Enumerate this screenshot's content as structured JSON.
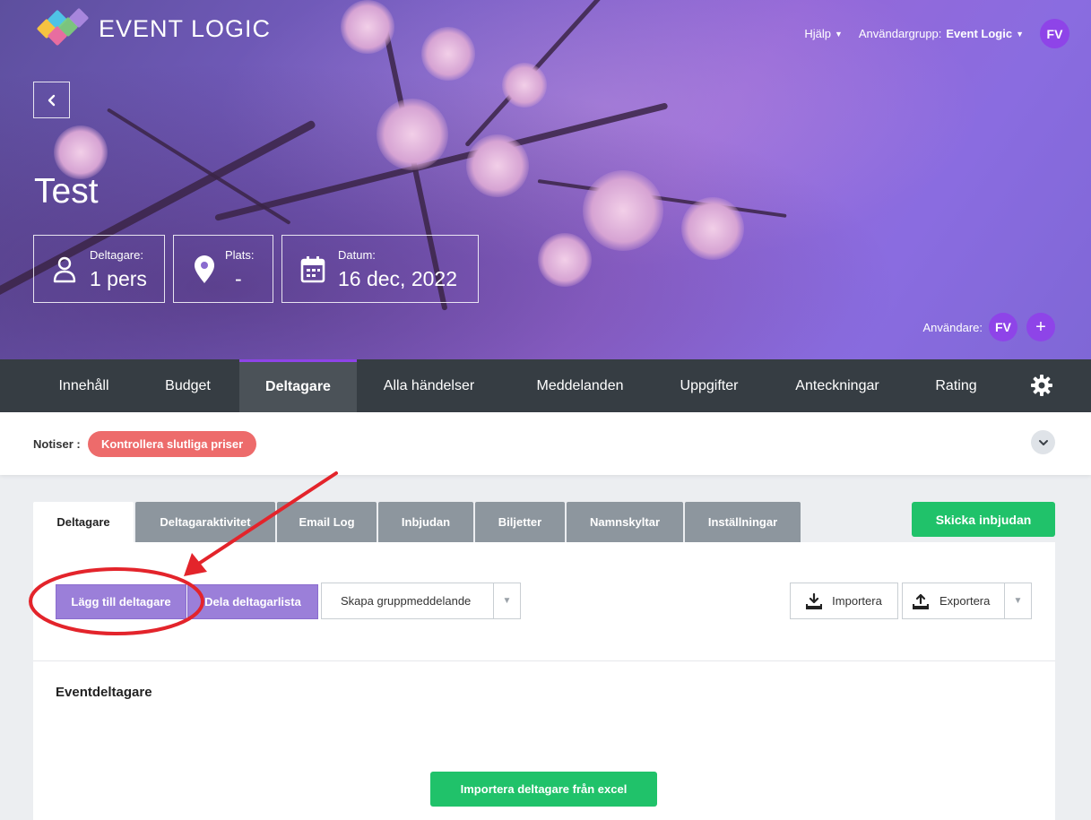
{
  "header": {
    "app_name": "EVENT LOGIC",
    "help_label": "Hjälp",
    "user_group_label": "Användargrupp:",
    "user_group_value": "Event Logic",
    "avatar_initials": "FV"
  },
  "event": {
    "title": "Test",
    "stats": [
      {
        "label": "Deltagare:",
        "value": "1 pers",
        "icon": "person-icon"
      },
      {
        "label": "Plats:",
        "value": "-",
        "icon": "location-pin-icon"
      },
      {
        "label": "Datum:",
        "value": "16 dec, 2022",
        "icon": "calendar-icon"
      }
    ],
    "users_label": "Användare:",
    "users_avatar": "FV",
    "add_user_symbol": "+"
  },
  "main_tabs": [
    {
      "label": "Innehåll"
    },
    {
      "label": "Budget"
    },
    {
      "label": "Deltagare",
      "active": true
    },
    {
      "label": "Alla händelser"
    },
    {
      "label": "Meddelanden"
    },
    {
      "label": "Uppgifter"
    },
    {
      "label": "Anteckningar"
    },
    {
      "label": "Rating"
    }
  ],
  "notices": {
    "label": "Notiser :",
    "pill": "Kontrollera slutliga priser"
  },
  "sub_tabs": [
    {
      "label": "Deltagare",
      "active": true
    },
    {
      "label": "Deltagaraktivitet"
    },
    {
      "label": "Email Log"
    },
    {
      "label": "Inbjudan"
    },
    {
      "label": "Biljetter"
    },
    {
      "label": "Namnskyltar"
    },
    {
      "label": "Inställningar"
    }
  ],
  "actions": {
    "send_invites": "Skicka inbjudan",
    "add_participant": "Lägg till deltagare",
    "share_list": "Dela deltagarlista",
    "group_message": "Skapa gruppmeddelande",
    "import": "Importera",
    "export": "Exportera"
  },
  "panel": {
    "section_title": "Eventdeltagare",
    "import_excel": "Importera deltagare från excel"
  },
  "colors": {
    "accent_purple": "#8e44e8",
    "button_purple": "#9b7fd9",
    "nav_dark": "#363d43",
    "success_green": "#20c26a",
    "notice_red": "#ed6b6b",
    "annotation_red": "#e3242b"
  }
}
